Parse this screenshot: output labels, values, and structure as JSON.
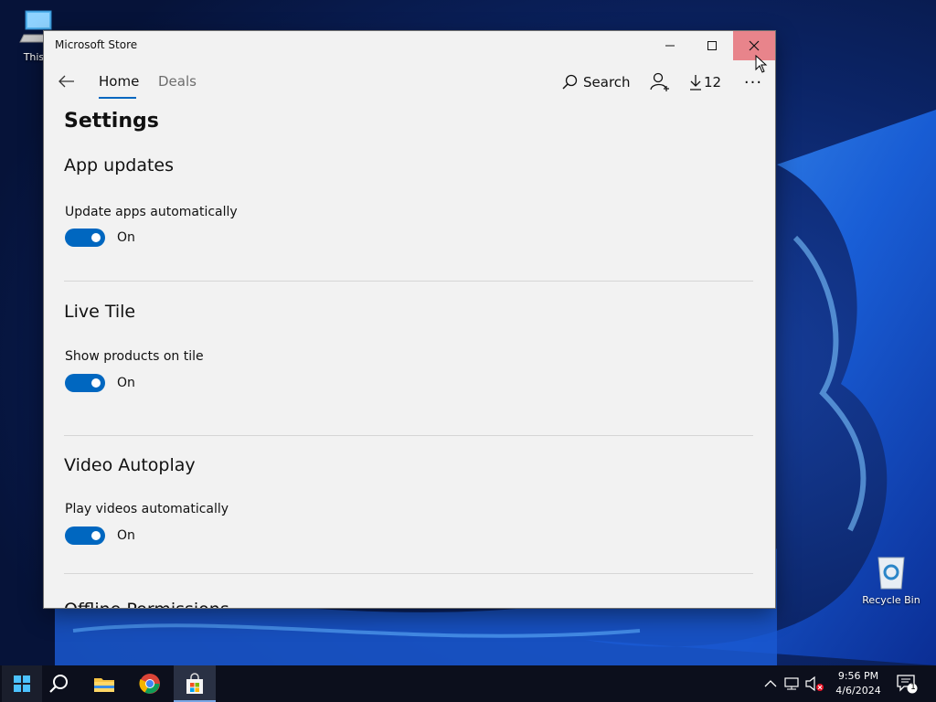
{
  "desktop": {
    "icons": [
      {
        "label": "This P"
      },
      {
        "label": "Recycle Bin"
      }
    ]
  },
  "window": {
    "title": "Microsoft Store",
    "caption_buttons": [
      "minimize",
      "maximize",
      "close"
    ]
  },
  "appbar": {
    "tabs": [
      {
        "label": "Home",
        "selected": true
      },
      {
        "label": "Deals",
        "selected": false
      }
    ],
    "search_label": "Search",
    "downloads_count": "12",
    "more_label": "···"
  },
  "settings": {
    "title": "Settings",
    "sections": [
      {
        "title": "App updates",
        "setting": "Update apps automatically",
        "state": "On"
      },
      {
        "title": "Live Tile",
        "setting": "Show products on tile",
        "state": "On"
      },
      {
        "title": "Video Autoplay",
        "setting": "Play videos automatically",
        "state": "On"
      },
      {
        "title": "Offline Permissions"
      }
    ]
  },
  "taskbar": {
    "time": "9:56 PM",
    "date": "4/6/2024",
    "notification_count": "1"
  },
  "colors": {
    "accent": "#0067c0",
    "close_hover": "#e8848b",
    "window_bg": "#f2f2f2",
    "taskbar_bg": "#0c0f1c"
  }
}
